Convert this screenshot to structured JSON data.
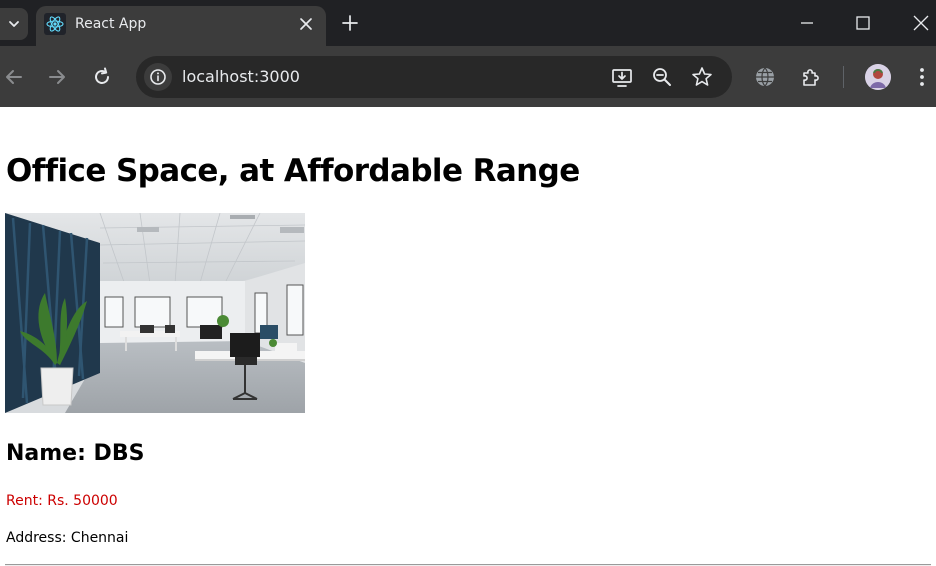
{
  "browser": {
    "tab": {
      "title": "React App",
      "favicon": "react-logo-icon"
    },
    "address_bar": {
      "url": "localhost:3000"
    },
    "icons": {
      "tab_search": "chevron-down-icon",
      "close_tab": "close-icon",
      "new_tab": "plus-icon",
      "minimize": "minimize-icon",
      "maximize": "maximize-icon",
      "close_window": "close-icon",
      "back": "arrow-left-icon",
      "forward": "arrow-right-icon",
      "reload": "reload-icon",
      "site_info": "info-icon",
      "install_app": "install-icon",
      "zoom": "zoom-out-icon",
      "bookmark": "star-icon",
      "translate": "globe-icon",
      "extensions": "puzzle-icon",
      "profile": "avatar",
      "menu": "kebab-menu-icon"
    }
  },
  "page": {
    "heading": "Office Space, at Affordable Range",
    "image": {
      "subject": "office interior photo"
    },
    "name": "Name: DBS",
    "rent": "Rent: Rs. 50000",
    "address": "Address: Chennai",
    "rent_color": "#cc0000"
  }
}
